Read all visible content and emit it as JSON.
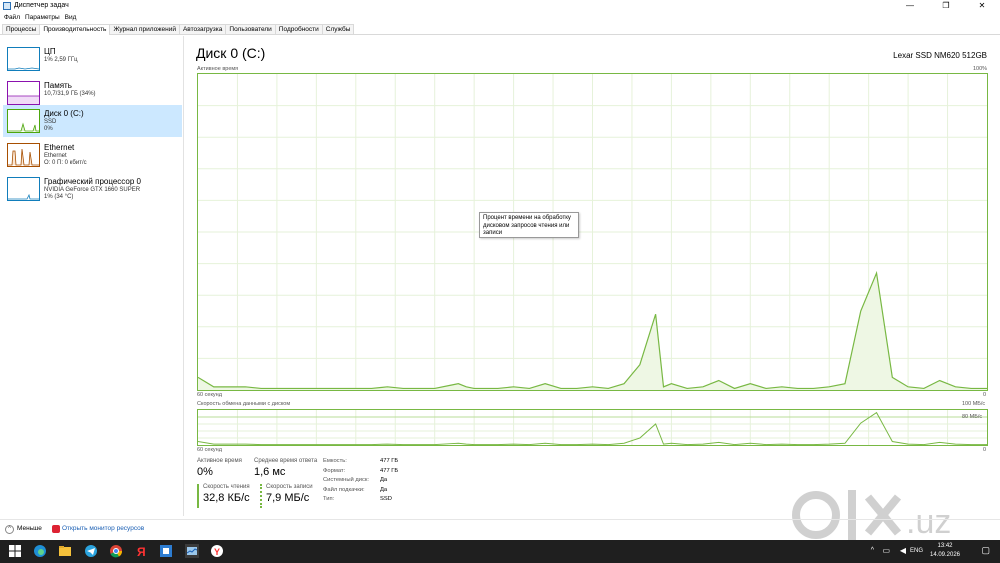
{
  "window": {
    "title": "Диспетчер задач"
  },
  "menu": [
    "Файл",
    "Параметры",
    "Вид"
  ],
  "tabs": [
    "Процессы",
    "Производительность",
    "Журнал приложений",
    "Автозагрузка",
    "Пользователи",
    "Подробности",
    "Службы"
  ],
  "active_tab": "Производительность",
  "sidebar": {
    "items": [
      {
        "name": "ЦП",
        "sub": "1% 2,59 ГГц",
        "sub2": "",
        "color": "#117dbb"
      },
      {
        "name": "Память",
        "sub": "10,7/31,9 ГБ (34%)",
        "sub2": "",
        "color": "#8b12ae"
      },
      {
        "name": "Диск 0 (C:)",
        "sub": "SSD",
        "sub2": "0%",
        "color": "#4da60c"
      },
      {
        "name": "Ethernet",
        "sub": "Ethernet",
        "sub2": "О: 0 П: 0 кбит/с",
        "color": "#a74f01"
      },
      {
        "name": "Графический процессор 0",
        "sub": "NVIDIA GeForce GTX 1660 SUPER",
        "sub2": "1% (34 °C)",
        "color": "#117dbb"
      }
    ]
  },
  "main": {
    "title": "Диск 0 (C:)",
    "model": "Lexar SSD NM620 512GB",
    "active_time_label": "Активное время",
    "max_label": "100%",
    "time_span_label": "60 секунд",
    "zero_label": "0",
    "transfer_label": "Скорость обмена данными с диском",
    "transfer_max": "100 МБ/с",
    "transfer_mid": "80 МБ/с",
    "tooltip": "Процент времени на обработку дисковом запросов чтения или записи"
  },
  "stats": {
    "active_time": {
      "label": "Активное время",
      "value": "0%"
    },
    "avg_response": {
      "label": "Среднее время ответа",
      "value": "1,6 мс"
    },
    "read_speed": {
      "label": "Скорость чтения",
      "value": "32,8 КБ/с"
    },
    "write_speed": {
      "label": "Скорость записи",
      "value": "7,9 МБ/с"
    }
  },
  "properties": [
    {
      "key": "Емкость:",
      "value": "477 ГБ"
    },
    {
      "key": "Формат:",
      "value": "477 ГБ"
    },
    {
      "key": "Системный диск:",
      "value": "Да"
    },
    {
      "key": "Файл подкачки:",
      "value": "Да"
    },
    {
      "key": "Тип:",
      "value": "SSD"
    }
  ],
  "footer": {
    "less": "Меньше",
    "monitor": "Открыть монитор ресурсов"
  },
  "taskbar": {
    "time": "13:42",
    "date": "14.09.2026",
    "lang": "ENG"
  },
  "watermark": "olx.uz",
  "chart_data": {
    "type": "area",
    "title": "Активное время",
    "x": [
      0,
      2,
      4,
      6,
      8,
      10,
      12,
      14,
      16,
      18,
      20,
      22,
      24,
      26,
      28,
      30,
      32,
      33,
      34,
      35,
      36,
      38,
      40,
      42,
      44,
      46,
      48,
      50,
      52,
      54,
      56,
      58,
      59,
      60,
      62,
      64,
      66,
      68,
      70,
      72,
      74,
      76,
      78,
      80,
      82,
      84,
      86,
      88,
      90,
      92,
      94,
      96,
      98,
      100
    ],
    "values": [
      4,
      1,
      1,
      1,
      0.5,
      0.5,
      0.5,
      0.5,
      0.5,
      0.5,
      0.5,
      0.5,
      1,
      0.5,
      0.5,
      0.5,
      1.5,
      2,
      1,
      0.5,
      0.5,
      0.5,
      1,
      0.5,
      2,
      0.5,
      0.5,
      1,
      0.5,
      2,
      8,
      24,
      1,
      2,
      0.5,
      1,
      3,
      0.5,
      2,
      0.5,
      1,
      0.5,
      0.5,
      1,
      2,
      25,
      37,
      4,
      1,
      0.5,
      3,
      1,
      0.5,
      0.5
    ],
    "ylim": [
      0,
      100
    ],
    "xlabel": "60 секунд"
  }
}
